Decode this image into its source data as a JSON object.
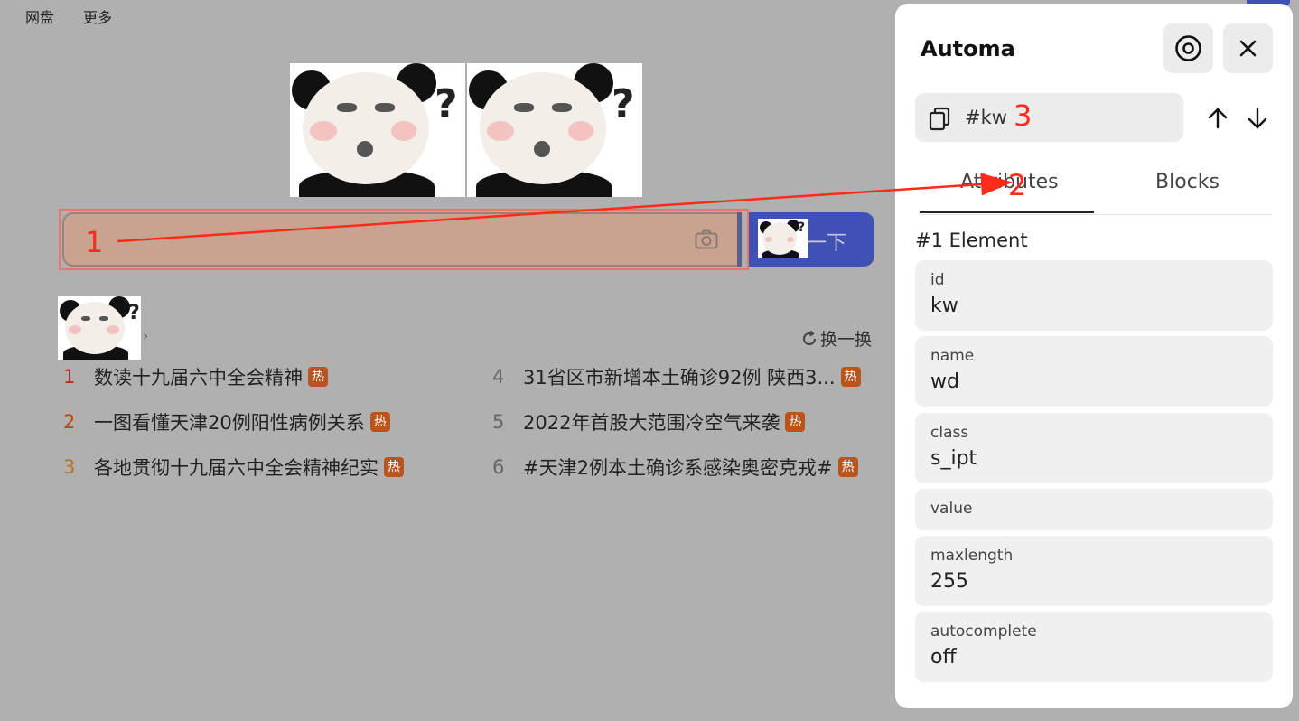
{
  "topnav": {
    "items": [
      "网盘",
      "更多"
    ]
  },
  "search": {
    "button_label": "一下"
  },
  "hotlist": {
    "refresh_label": "换一换",
    "hot_tag": "热",
    "items": [
      {
        "rank": "1",
        "title": "数读十九届六中全会精神",
        "color": "#b3261e"
      },
      {
        "rank": "2",
        "title": "一图看懂天津20例阳性病例关系",
        "color": "#c0441a"
      },
      {
        "rank": "3",
        "title": "各地贯彻十九届六中全会精神纪实",
        "color": "#b5742a"
      },
      {
        "rank": "4",
        "title": "31省区市新增本土确诊92例 陕西3...",
        "color": "#666666"
      },
      {
        "rank": "5",
        "title": "2022年首股大范围冷空气来袭",
        "color": "#666666"
      },
      {
        "rank": "6",
        "title": "#天津2例本土确诊系感染奥密克戎#",
        "color": "#666666"
      }
    ]
  },
  "annotations": {
    "one": "1",
    "two": "2",
    "three": "3"
  },
  "panel": {
    "title": "Automa",
    "selector": "#kw",
    "tabs": [
      "Attributes",
      "Blocks"
    ],
    "element_title": "#1 Element",
    "attributes": [
      {
        "key": "id",
        "value": "kw"
      },
      {
        "key": "name",
        "value": "wd"
      },
      {
        "key": "class",
        "value": "s_ipt"
      },
      {
        "key": "value",
        "value": ""
      },
      {
        "key": "maxlength",
        "value": "255"
      },
      {
        "key": "autocomplete",
        "value": "off"
      }
    ]
  },
  "colors": {
    "accent": "#3f51b5",
    "annotation": "#ff2a1a",
    "hot_tag": "#b8541c"
  }
}
